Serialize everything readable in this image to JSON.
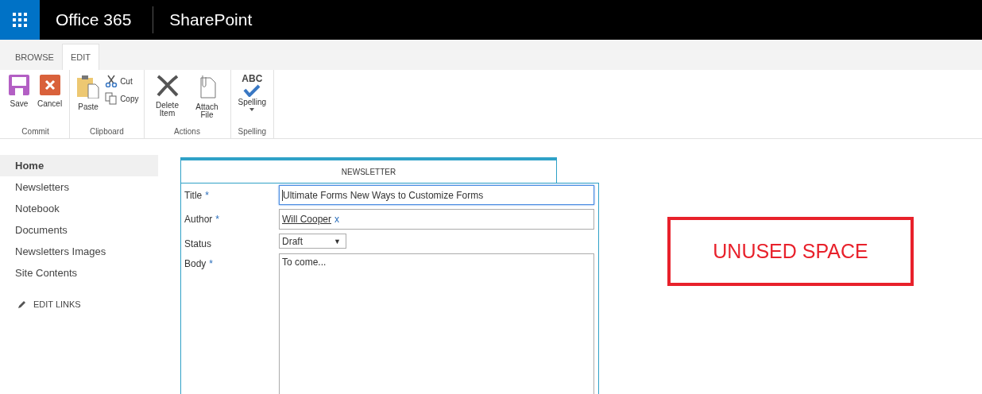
{
  "top_bar": {
    "suite": "Office 365",
    "app": "SharePoint"
  },
  "ribbon": {
    "tabs": [
      {
        "label": "BROWSE",
        "selected": false
      },
      {
        "label": "EDIT",
        "selected": true
      }
    ],
    "groups": [
      {
        "name": "Commit",
        "buttons": [
          {
            "label": "Save",
            "kind": "large"
          },
          {
            "label": "Cancel",
            "kind": "large"
          }
        ]
      },
      {
        "name": "Clipboard",
        "buttons": [
          {
            "label": "Paste",
            "kind": "large"
          },
          {
            "label": "Cut",
            "kind": "small"
          },
          {
            "label": "Copy",
            "kind": "small"
          }
        ]
      },
      {
        "name": "Actions",
        "buttons": [
          {
            "label": "Delete Item",
            "kind": "large"
          },
          {
            "label": "Attach File",
            "kind": "large"
          }
        ]
      },
      {
        "name": "Spelling",
        "buttons": [
          {
            "label": "Spelling",
            "kind": "large",
            "icon_text": "ABC",
            "dropdown": true
          }
        ]
      }
    ]
  },
  "nav": {
    "items": [
      {
        "label": "Home",
        "selected": true
      },
      {
        "label": "Newsletters",
        "selected": false
      },
      {
        "label": "Notebook",
        "selected": false
      },
      {
        "label": "Documents",
        "selected": false
      },
      {
        "label": "Newsletters Images",
        "selected": false
      },
      {
        "label": "Site Contents",
        "selected": false
      }
    ],
    "edit_links": "EDIT LINKS"
  },
  "form": {
    "tab": "NEWSLETTER",
    "fields": [
      {
        "kind": "text",
        "label": "Title",
        "required_mark": "*",
        "value": "Ultimate Forms New Ways to Customize Forms"
      },
      {
        "kind": "person",
        "label": "Author",
        "required_mark": "*",
        "value": "Will Cooper",
        "remove": "x"
      },
      {
        "kind": "choice",
        "label": "Status",
        "value": "Draft",
        "arrow": "▼"
      },
      {
        "kind": "note",
        "label": "Body",
        "required_mark": "*",
        "value": "To come..."
      }
    ]
  },
  "annotation": {
    "text": "UNUSED SPACE"
  }
}
